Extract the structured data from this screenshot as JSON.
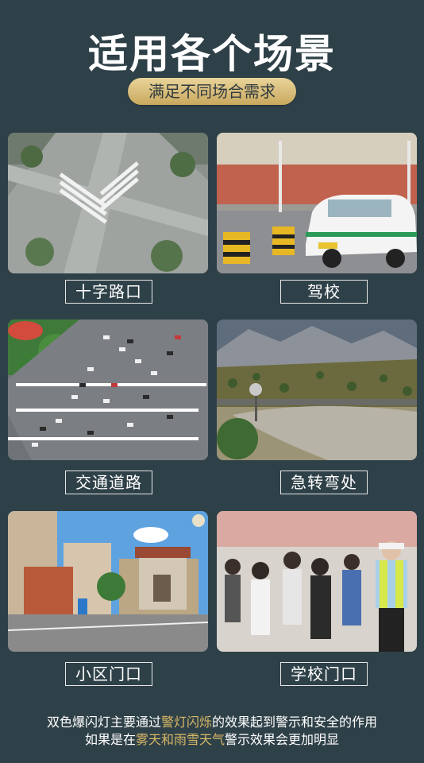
{
  "header": {
    "title": "适用各个场景",
    "subtitle": "满足不同场合需求"
  },
  "scenes": [
    {
      "label": "十字路口"
    },
    {
      "label": "驾校"
    },
    {
      "label": "交通道路"
    },
    {
      "label": "急转弯处"
    },
    {
      "label": "小区门口"
    },
    {
      "label": "学校门口"
    }
  ],
  "footer": {
    "line1_pre": "双色爆闪灯主要通过",
    "line1_highlight": "警灯闪烁",
    "line1_post": "的效果起到警示和安全的作用",
    "line2_pre": "如果是在",
    "line2_highlight": "雾天和雨雪天气",
    "line2_post": "警示效果会更加明显"
  },
  "colors": {
    "background": "#2f4148",
    "accent_gold": "#d8b866"
  }
}
